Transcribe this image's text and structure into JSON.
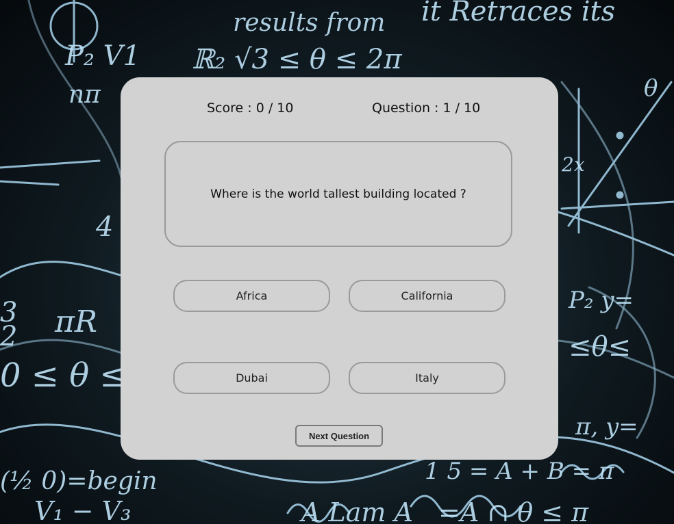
{
  "background": {
    "description_icon": "math-chalkboard-icon",
    "accent": "#a9d6f0"
  },
  "quiz": {
    "score_label": "Score : 0 / 10",
    "question_count_label": "Question : 1 / 10",
    "question_text": "Where is the world tallest building located ?",
    "answers": [
      {
        "label": "Africa"
      },
      {
        "label": "California"
      },
      {
        "label": "Dubai"
      },
      {
        "label": "Italy"
      }
    ],
    "next_button_label": "Next Question"
  }
}
